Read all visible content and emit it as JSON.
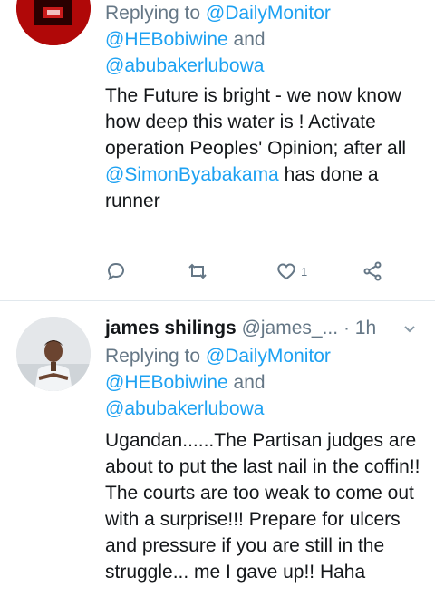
{
  "tweet1": {
    "replying_prefix": "Replying to ",
    "mentions": [
      "@DailyMonitor",
      "@HEBobiwine",
      "@abubakerlubowa"
    ],
    "and": " and",
    "text_part1": "The Future is bright - we now know how deep this water is ! Activate operation Peoples' Opinion; after all ",
    "text_mention": "@SimonByabakama",
    "text_part2": " has done a runner",
    "like_count": "1"
  },
  "tweet2": {
    "name": "james shilings",
    "handle": "@james_...",
    "dot": " · ",
    "time": "1h",
    "replying_prefix": "Replying to ",
    "mentions": [
      "@DailyMonitor",
      "@HEBobiwine",
      "@abubakerlubowa"
    ],
    "and": " and",
    "text": "Ugandan......The Partisan judges are about to put the last nail in the coffin!! The courts are too weak to come out with a surprise!!! Prepare for ulcers and pressure if you are still in the struggle... me I gave up!! Haha"
  },
  "icons": [
    "reply-icon",
    "retweet-icon",
    "like-icon",
    "share-icon",
    "caret-down-icon"
  ]
}
